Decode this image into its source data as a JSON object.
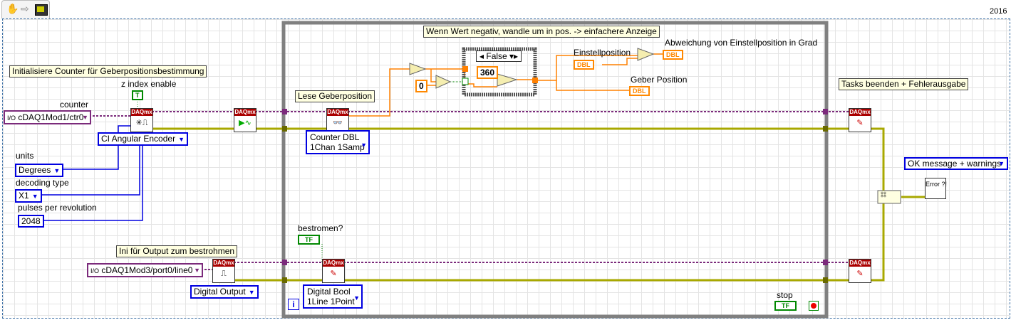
{
  "toolbar": {
    "version": "2016",
    "icons": [
      "operate-hand-icon",
      "step-arrow-icon",
      "highlight-execution-icon"
    ]
  },
  "comments": {
    "init_counter": "Initialisiere Counter für Geberpositionsbestimmung",
    "read_position": "Lese Geberposition",
    "negative": "Wenn Wert negativ, wandle um in pos. -> einfachere Anzeige",
    "tasks_end": "Tasks beenden + Fehlerausgabe",
    "ini_output": "Ini für Output zum bestrohmen"
  },
  "labels": {
    "counter": "counter",
    "z_index_enable": "z index enable",
    "units": "units",
    "decoding_type": "decoding type",
    "pulses": "pulses per revolution",
    "einstellposition": "Einstellposition",
    "abweichung": "Abweichung von Einstellposition in Grad",
    "geber_position": "Geber Position",
    "bestromen": "bestromen?",
    "stop": "stop"
  },
  "controls": {
    "counter_value": "cDAQ1Mod1/ctr0",
    "output_line": "cDAQ1Mod3/port0/line0",
    "z_index": "T",
    "units_value": "Degrees",
    "decoding_value": "X1",
    "pulses_value": "2048",
    "bestromen_value": "TF",
    "stop_value": "TF"
  },
  "rings": {
    "ci_type": "CI Angular Encoder",
    "read_type": "Counter DBL 1Chan 1Samp",
    "output_type": "Digital Output",
    "write_type": "Digital Bool 1Line 1Point",
    "error_msg": "OK message + warnings"
  },
  "case": {
    "selector": "False",
    "constant_360": "360",
    "constant_0": "0"
  },
  "indicators": {
    "dbl": "DBL"
  },
  "daqmx": {
    "header": "DAQmx"
  },
  "loop": {
    "iteration": "i"
  },
  "error_handler": "Error ?!",
  "colors": {
    "task_wire": "#7b2a7b",
    "error_wire": "#c8c800",
    "dbl_wire": "#ff8000",
    "bool_wire": "#008000",
    "loop": "#808080"
  }
}
